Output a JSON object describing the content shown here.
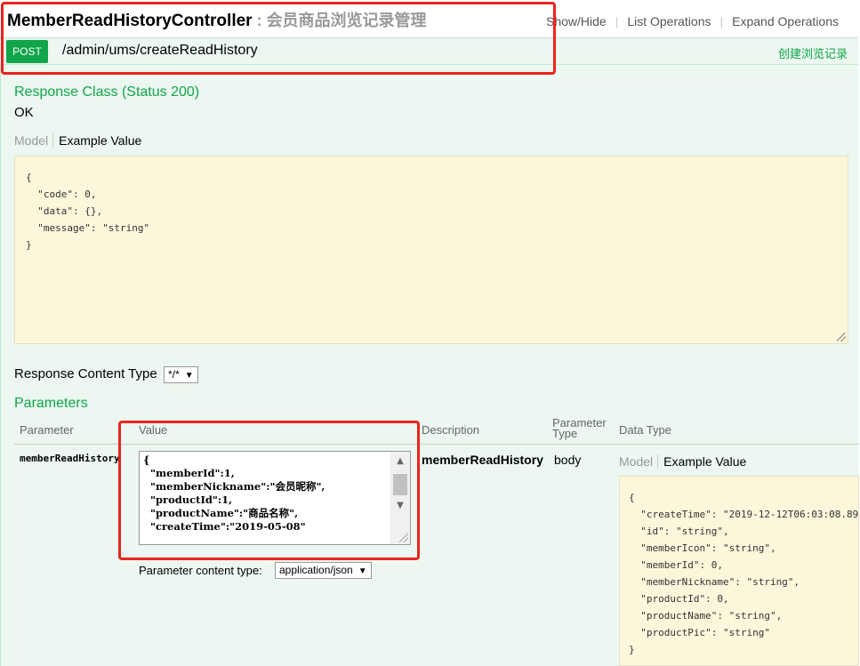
{
  "controller": {
    "name": "MemberReadHistoryController",
    "separator": " : ",
    "description": "会员商品浏览记录管理"
  },
  "header_links": [
    "Show/Hide",
    "List Operations",
    "Expand Operations"
  ],
  "operation": {
    "method": "POST",
    "path": "/admin/ums/createReadHistory",
    "summary": "创建浏览记录"
  },
  "response": {
    "class_heading": "Response Class (Status 200)",
    "status_text": "OK",
    "tab_model": "Model",
    "tab_example": "Example Value",
    "example_lines": [
      "{",
      "  \"code\": 0,",
      "  \"data\": {},",
      "  \"message\": \"string\"",
      "}"
    ],
    "content_type_label": "Response Content Type",
    "content_type_value": "*/*"
  },
  "parameters": {
    "heading": "Parameters",
    "columns": [
      "Parameter",
      "Value",
      "Description",
      "Parameter Type",
      "Data Type"
    ],
    "row": {
      "name": "memberReadHistory",
      "value_lines": [
        "{",
        "  \"memberId\":1,",
        "  \"memberNickname\":\"会员昵称\",",
        "  \"productId\":1,",
        "  \"productName\":\"商品名称\",",
        "  \"createTime\":\"2019-05-08\"",
        "}"
      ],
      "description": "memberReadHistory",
      "param_type": "body",
      "content_type_label": "Parameter content type:",
      "content_type_value": "application/json",
      "model_tab": "Model",
      "example_tab": "Example Value",
      "model_lines": [
        "{",
        "  \"createTime\": \"2019-12-12T06:03:08.89",
        "  \"id\": \"string\",",
        "  \"memberIcon\": \"string\",",
        "  \"memberId\": 0,",
        "  \"memberNickname\": \"string\",",
        "  \"productId\": 0,",
        "  \"productName\": \"string\",",
        "  \"productPic\": \"string\"",
        "}"
      ]
    }
  },
  "colors": {
    "post_green": "#10a54a",
    "panel_bg": "#ebf7f0",
    "highlight_red": "#e8251f",
    "code_bg": "#fcf6db"
  }
}
